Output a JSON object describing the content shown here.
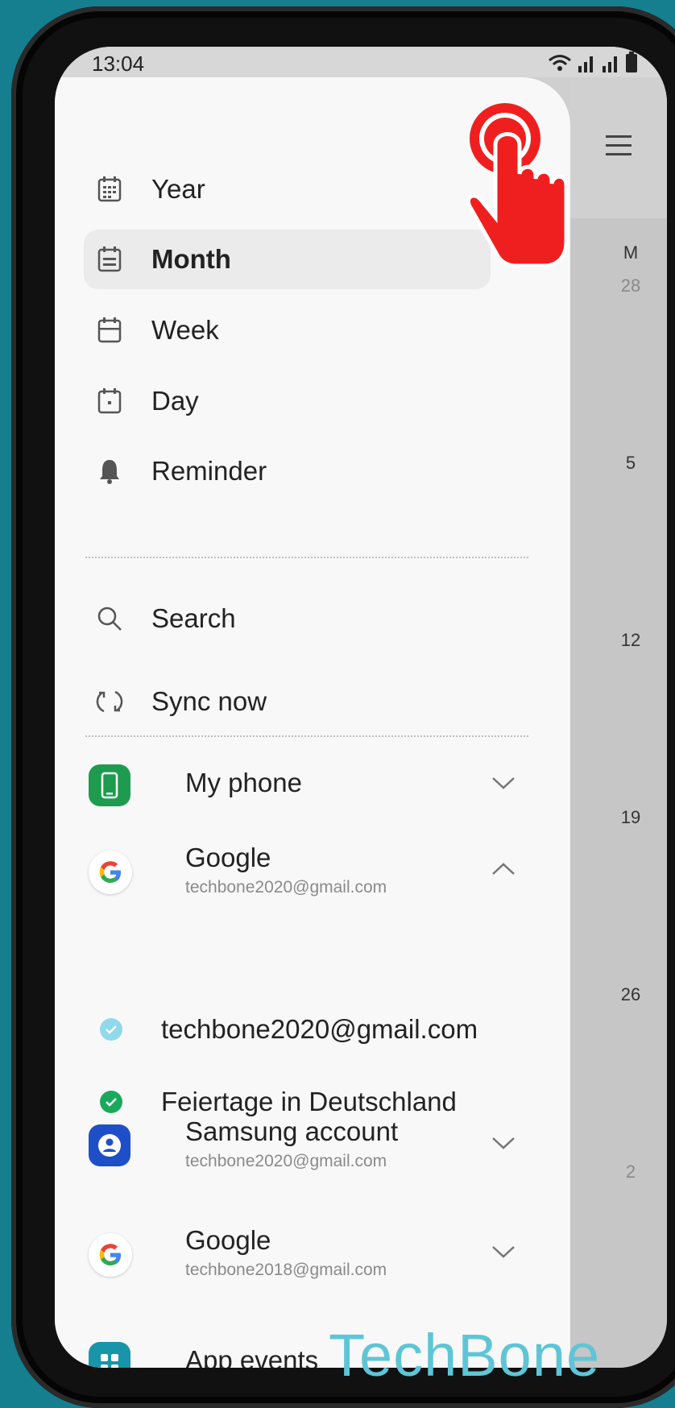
{
  "status_bar": {
    "time": "13:04"
  },
  "drawer": {
    "views": [
      {
        "label": "Year",
        "icon": "calendar-grid-icon",
        "active": false
      },
      {
        "label": "Month",
        "icon": "calendar-month-icon",
        "active": true
      },
      {
        "label": "Week",
        "icon": "calendar-week-icon",
        "active": false
      },
      {
        "label": "Day",
        "icon": "calendar-day-icon",
        "active": false
      },
      {
        "label": "Reminder",
        "icon": "bell-icon",
        "active": false
      }
    ],
    "actions": [
      {
        "label": "Search",
        "icon": "search-icon"
      },
      {
        "label": "Sync now",
        "icon": "sync-icon"
      }
    ],
    "accounts": [
      {
        "name": "My phone",
        "email": "",
        "icon": "phone-icon",
        "expanded": false
      },
      {
        "name": "Google",
        "email": "techbone2020@gmail.com",
        "icon": "google-icon",
        "expanded": true
      },
      {
        "name": "Samsung account",
        "email": "techbone2020@gmail.com",
        "icon": "samsung-account-icon",
        "expanded": false
      },
      {
        "name": "Google",
        "email": "techbone2018@gmail.com",
        "icon": "google-icon",
        "expanded": false
      },
      {
        "name": "App events",
        "email": "",
        "icon": "app-events-icon",
        "expanded": false
      }
    ],
    "google_calendars": [
      {
        "label": "techbone2020@gmail.com",
        "color": "#8fd9ea"
      },
      {
        "label": "Feiertage in Deutschland",
        "color": "#1aa95c"
      }
    ]
  },
  "calendar_peek": {
    "weekday": "M",
    "days": [
      "28",
      "5",
      "12",
      "19",
      "26",
      "2"
    ]
  },
  "watermark": "TechBone",
  "colors": {
    "accent_red": "#f01f1f",
    "background": "#157e8f",
    "watermark": "#5fc5d6"
  }
}
